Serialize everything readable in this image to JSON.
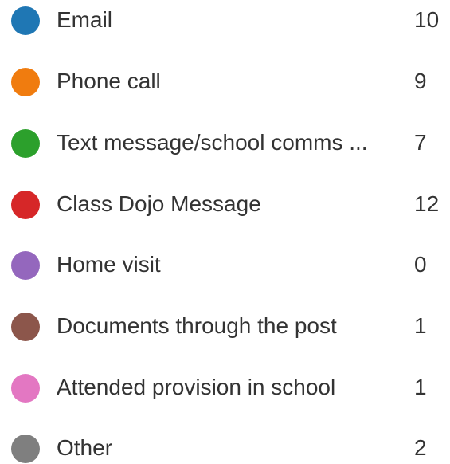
{
  "legend": {
    "items": [
      {
        "label": "Email",
        "count": "10",
        "color": "#1f77b4"
      },
      {
        "label": "Phone call",
        "count": "9",
        "color": "#f07c0f"
      },
      {
        "label": "Text message/school comms ...",
        "count": "7",
        "color": "#2ca02c"
      },
      {
        "label": "Class Dojo Message",
        "count": "12",
        "color": "#d62728"
      },
      {
        "label": "Home visit",
        "count": "0",
        "color": "#9467bd"
      },
      {
        "label": "Documents through the post",
        "count": "1",
        "color": "#8c564b"
      },
      {
        "label": "Attended provision in school",
        "count": "1",
        "color": "#e377c2"
      },
      {
        "label": "Other",
        "count": "2",
        "color": "#7f7f7f"
      }
    ]
  }
}
